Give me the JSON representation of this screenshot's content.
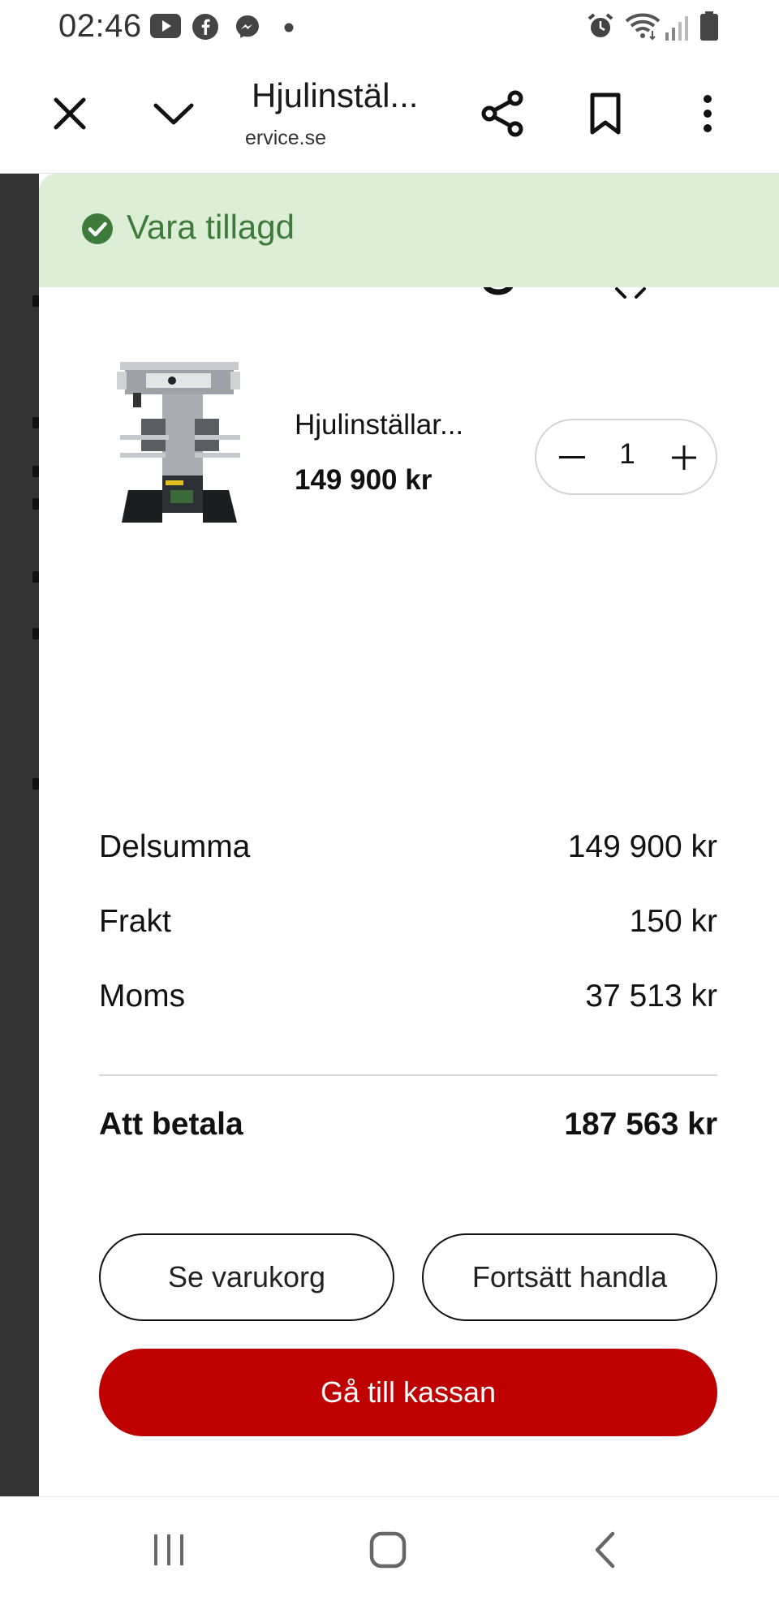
{
  "status_bar": {
    "time": "02:46",
    "app_icons": [
      "youtube-icon",
      "facebook-icon",
      "messenger-icon",
      "dot-icon"
    ],
    "system_icons": [
      "alarm-icon",
      "wifi-icon",
      "signal-icon",
      "battery-icon"
    ]
  },
  "toolbar": {
    "title": "Hjulinstäl...",
    "url": "ervice.se",
    "icons": [
      "close-icon",
      "chevron-down-icon",
      "share-icon",
      "bookmark-icon",
      "more-vert-icon"
    ]
  },
  "toast": {
    "message": "Vara tillagd",
    "icon": "check-circle-icon",
    "color": "#3e7b3a",
    "background": "#dceed6"
  },
  "cart": {
    "items": [
      {
        "name": "Hjulinställar...",
        "price": "149 900 kr",
        "quantity": "1"
      }
    ],
    "summary": [
      {
        "label": "Delsumma",
        "value": "149 900 kr"
      },
      {
        "label": "Frakt",
        "value": "150 kr"
      },
      {
        "label": "Moms",
        "value": "37 513 kr"
      }
    ],
    "total": {
      "label": "Att betala",
      "value": "187 563 kr"
    },
    "buttons": {
      "view_cart": "Se varukorg",
      "continue_shopping": "Fortsätt handla",
      "checkout": "Gå till kassan"
    },
    "accent_color": "#be0000"
  },
  "navbar": {
    "icons": [
      "recent-apps-icon",
      "home-icon",
      "back-icon"
    ]
  }
}
